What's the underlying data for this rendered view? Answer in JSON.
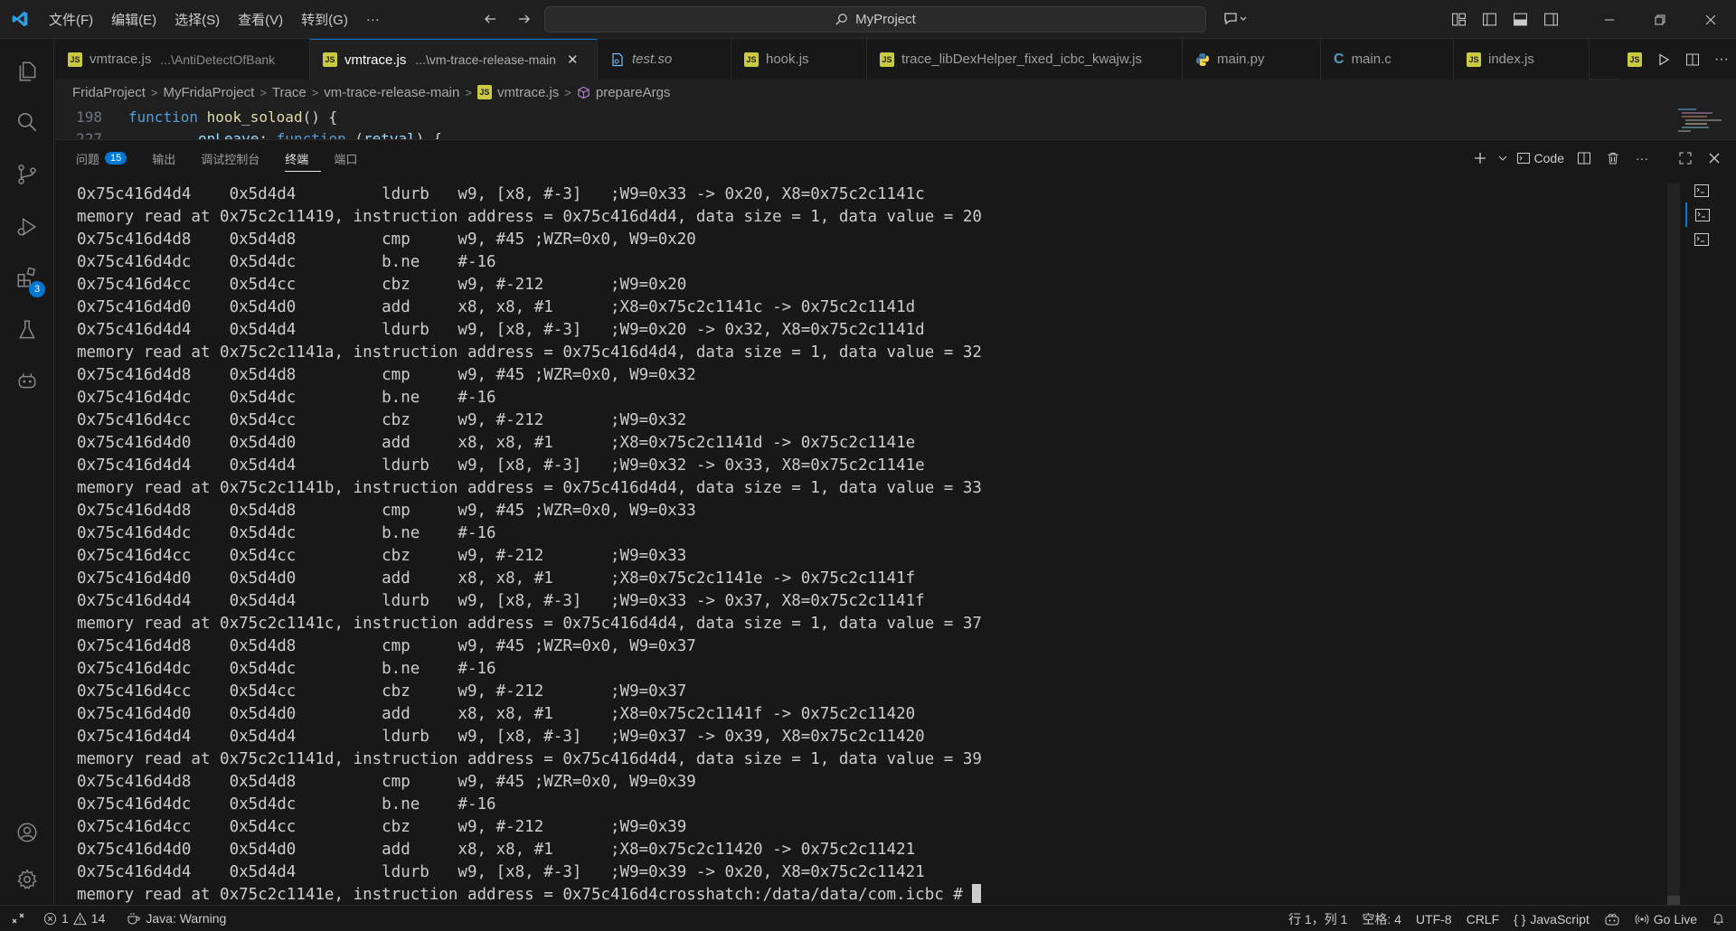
{
  "titlebar": {
    "menus": [
      "文件(F)",
      "编辑(E)",
      "选择(S)",
      "查看(V)",
      "转到(G)",
      "···"
    ],
    "search_text": "MyProject"
  },
  "activity": {
    "extensions_badge": "3"
  },
  "tabs": [
    {
      "name": "vmtrace.js",
      "desc": "...\\AntiDetectOfBank",
      "active": false
    },
    {
      "name": "vmtrace.js",
      "desc": "...\\vm-trace-release-main",
      "active": true
    },
    {
      "name": "test.so",
      "desc": "",
      "active": false
    },
    {
      "name": "hook.js",
      "desc": "",
      "active": false
    },
    {
      "name": "trace_libDexHelper_fixed_icbc_kwajw.js",
      "desc": "",
      "active": false
    },
    {
      "name": "main.py",
      "desc": "",
      "active": false
    },
    {
      "name": "main.c",
      "desc": "",
      "active": false
    },
    {
      "name": "index.js",
      "desc": "",
      "active": false
    }
  ],
  "breadcrumb": [
    "FridaProject",
    "MyFridaProject",
    "Trace",
    "vm-trace-release-main",
    "vmtrace.js",
    "prepareArgs"
  ],
  "editor_peek": [
    {
      "ln": "198",
      "kw": "function",
      "fn": "hook_soload",
      "rest": "() {"
    },
    {
      "ln": "227",
      "prop": "onLeave",
      "sep": ": ",
      "kw": "function",
      "rest": " (",
      "param": "retval",
      "end": ") {"
    }
  ],
  "panel": {
    "tabs": [
      "问题",
      "输出",
      "调试控制台",
      "终端",
      "端口"
    ],
    "problems_count": "15",
    "code_label": "Code"
  },
  "terminal": {
    "lines": [
      "0x75c416d4d4    0x5d4d4         ldurb   w9, [x8, #-3]   ;W9=0x33 -> 0x20, X8=0x75c2c1141c",
      "memory read at 0x75c2c11419, instruction address = 0x75c416d4d4, data size = 1, data value = 20",
      "0x75c416d4d8    0x5d4d8         cmp     w9, #45 ;WZR=0x0, W9=0x20",
      "0x75c416d4dc    0x5d4dc         b.ne    #-16",
      "0x75c416d4cc    0x5d4cc         cbz     w9, #-212       ;W9=0x20",
      "0x75c416d4d0    0x5d4d0         add     x8, x8, #1      ;X8=0x75c2c1141c -> 0x75c2c1141d",
      "0x75c416d4d4    0x5d4d4         ldurb   w9, [x8, #-3]   ;W9=0x20 -> 0x32, X8=0x75c2c1141d",
      "memory read at 0x75c2c1141a, instruction address = 0x75c416d4d4, data size = 1, data value = 32",
      "0x75c416d4d8    0x5d4d8         cmp     w9, #45 ;WZR=0x0, W9=0x32",
      "0x75c416d4dc    0x5d4dc         b.ne    #-16",
      "0x75c416d4cc    0x5d4cc         cbz     w9, #-212       ;W9=0x32",
      "0x75c416d4d0    0x5d4d0         add     x8, x8, #1      ;X8=0x75c2c1141d -> 0x75c2c1141e",
      "0x75c416d4d4    0x5d4d4         ldurb   w9, [x8, #-3]   ;W9=0x32 -> 0x33, X8=0x75c2c1141e",
      "memory read at 0x75c2c1141b, instruction address = 0x75c416d4d4, data size = 1, data value = 33",
      "0x75c416d4d8    0x5d4d8         cmp     w9, #45 ;WZR=0x0, W9=0x33",
      "0x75c416d4dc    0x5d4dc         b.ne    #-16",
      "0x75c416d4cc    0x5d4cc         cbz     w9, #-212       ;W9=0x33",
      "0x75c416d4d0    0x5d4d0         add     x8, x8, #1      ;X8=0x75c2c1141e -> 0x75c2c1141f",
      "0x75c416d4d4    0x5d4d4         ldurb   w9, [x8, #-3]   ;W9=0x33 -> 0x37, X8=0x75c2c1141f",
      "memory read at 0x75c2c1141c, instruction address = 0x75c416d4d4, data size = 1, data value = 37",
      "0x75c416d4d8    0x5d4d8         cmp     w9, #45 ;WZR=0x0, W9=0x37",
      "0x75c416d4dc    0x5d4dc         b.ne    #-16",
      "0x75c416d4cc    0x5d4cc         cbz     w9, #-212       ;W9=0x37",
      "0x75c416d4d0    0x5d4d0         add     x8, x8, #1      ;X8=0x75c2c1141f -> 0x75c2c11420",
      "0x75c416d4d4    0x5d4d4         ldurb   w9, [x8, #-3]   ;W9=0x37 -> 0x39, X8=0x75c2c11420",
      "memory read at 0x75c2c1141d, instruction address = 0x75c416d4d4, data size = 1, data value = 39",
      "0x75c416d4d8    0x5d4d8         cmp     w9, #45 ;WZR=0x0, W9=0x39",
      "0x75c416d4dc    0x5d4dc         b.ne    #-16",
      "0x75c416d4cc    0x5d4cc         cbz     w9, #-212       ;W9=0x39",
      "0x75c416d4d0    0x5d4d0         add     x8, x8, #1      ;X8=0x75c2c11420 -> 0x75c2c11421",
      "0x75c416d4d4    0x5d4d4         ldurb   w9, [x8, #-3]   ;W9=0x39 -> 0x20, X8=0x75c2c11421"
    ],
    "last_line": "memory read at 0x75c2c1141e, instruction address = 0x75c416d4crosshatch:/data/data/com.icbc # "
  },
  "statusbar": {
    "errors": "1",
    "warnings": "14",
    "java_status": "Java: Warning",
    "position": "行 1，列 1",
    "spaces": "空格: 4",
    "encoding": "UTF-8",
    "eol": "CRLF",
    "language": "JavaScript",
    "go_live": "Go Live"
  },
  "colors": {
    "accent": "#0078d4",
    "js_icon": "#cbcb41",
    "c_icon": "#519aba",
    "keyword": "#569cd6",
    "function": "#dcdcaa"
  }
}
